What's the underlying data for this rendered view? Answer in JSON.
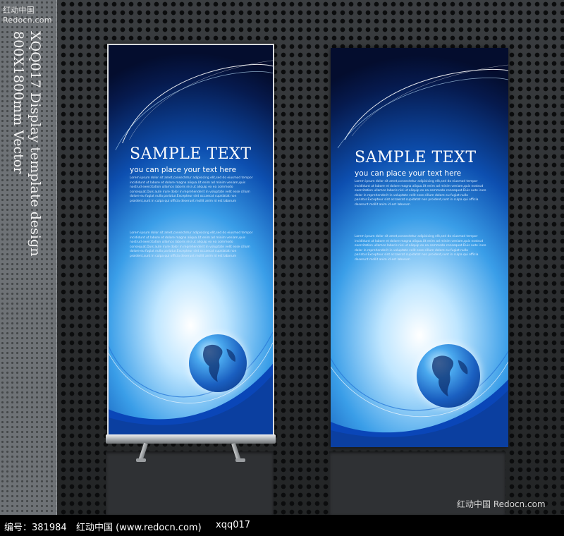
{
  "watermark": {
    "top_left": "红动中国 Redocn.com",
    "bottom_right": "红动中国 Redocn.com"
  },
  "side_text": {
    "line1": "XQQ017 Display template design",
    "line2": "800X1800mm Vector"
  },
  "banners": [
    {
      "title": "SAMPLE TEXT",
      "subtitle": "you can place your text here",
      "body_paragraph_1": "Lorem ipsum dolor sit amet,consectetur adipisicing elit,sed do eiusmod tempor incididunt ut labore et dolore magna aliqua.Ut enim ad minim veniam,quis nostrud exercitation ullamco laboris nisi ut aliquip ex ea commodo consequat.Duis aute irure dolor in reprehenderit in voluptate velit esse cillum dolore eu fugiat nulla pariatur.Excepteur sint occaecat cupidatat non proident,sunt in culpa qui officia deserunt mollit anim id est laborum",
      "body_paragraph_2": "Lorem ipsum dolor sit amet,consectetur adipisicing elit,sed do eiusmod tempor incididunt ut labore et dolore magna aliqua.Ut enim ad minim veniam,quis nostrud exercitation ullamco laboris nisi ut aliquip ex ea commodo consequat.Duis aute irure dolor in reprehenderit in voluptate velit esse cillum dolore eu fugiat nulla pariatur.Excepteur sint occaecat cupidatat non proident,sunt in culpa qui officia deserunt mollit anim id est laborum"
    },
    {
      "title": "SAMPLE TEXT",
      "subtitle": "you can place your text here",
      "body_paragraph_1": "Lorem ipsum dolor sit amet,consectetur adipisicing elit,sed do eiusmod tempor incididunt ut labore et dolore magna aliqua.Ut enim ad minim veniam,quis nostrud exercitation ullamco laboris nisi ut aliquip ex ea commodo consequat.Duis aute irure dolor in reprehenderit in voluptate velit esse cillum dolore eu fugiat nulla pariatur.Excepteur sint occaecat cupidatat non proident,sunt in culpa qui officia deserunt mollit anim id est laborum",
      "body_paragraph_2": "Lorem ipsum dolor sit amet,consectetur adipisicing elit,sed do eiusmod tempor incididunt ut labore et dolore magna aliqua.Ut enim ad minim veniam,quis nostrud exercitation ullamco laboris nisi ut aliquip ex ea commodo consequat.Duis aute irure dolor in reprehenderit in voluptate velit esse cillum dolore eu fugiat nulla pariatur.Excepteur sint occaecat cupidatat non proident,sunt in culpa qui officia deserunt mollit anim id est laborum"
    }
  ],
  "footer": {
    "id_text": "编号：381984",
    "site_text": "红动中国 (www.redocn.com)",
    "code_text": "xqq017"
  },
  "colors": {
    "background": "#2a2c2e",
    "banner_dark": "#061a4e",
    "banner_mid": "#0d4fb0",
    "banner_light": "#bfe6ff",
    "footer": "#000000"
  },
  "icons": [
    "globe-icon"
  ]
}
